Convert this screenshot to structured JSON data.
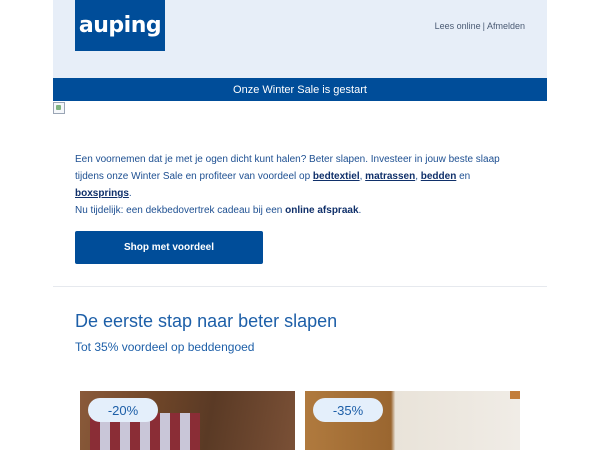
{
  "header": {
    "logo_text": "auping",
    "links": {
      "view_online": "Lees online",
      "separator": "|",
      "unsubscribe": "Afmelden"
    }
  },
  "banner": {
    "text": "Onze Winter Sale is gestart"
  },
  "intro": {
    "line1": "Een voornemen dat je met je ogen dicht kunt halen? Beter slapen. Investeer in jouw beste slaap tijdens onze Winter Sale en profiteer van voordeel op ",
    "link_bedtextiel": "bedtextiel",
    "comma1": ", ",
    "link_matrassen": "matrassen",
    "comma2": ", ",
    "link_bedden": "bedden",
    "and": " en ",
    "link_boxsprings": "boxsprings",
    "period": ".",
    "line2_prefix": "Nu tijdelijk: een dekbedovertrek cadeau bij een ",
    "link_afspraak": "online afspraak",
    "line2_suffix": "."
  },
  "cta": {
    "label": "Shop met voordeel"
  },
  "section": {
    "title": "De eerste stap naar beter slapen",
    "subtitle": "Tot 35% voordeel op beddengoed"
  },
  "products": [
    {
      "badge": "-20%"
    },
    {
      "badge": "-35%"
    }
  ],
  "colors": {
    "brand": "#004d99",
    "header_bg": "#e7eef8",
    "accent_text": "#1d5fa8"
  }
}
